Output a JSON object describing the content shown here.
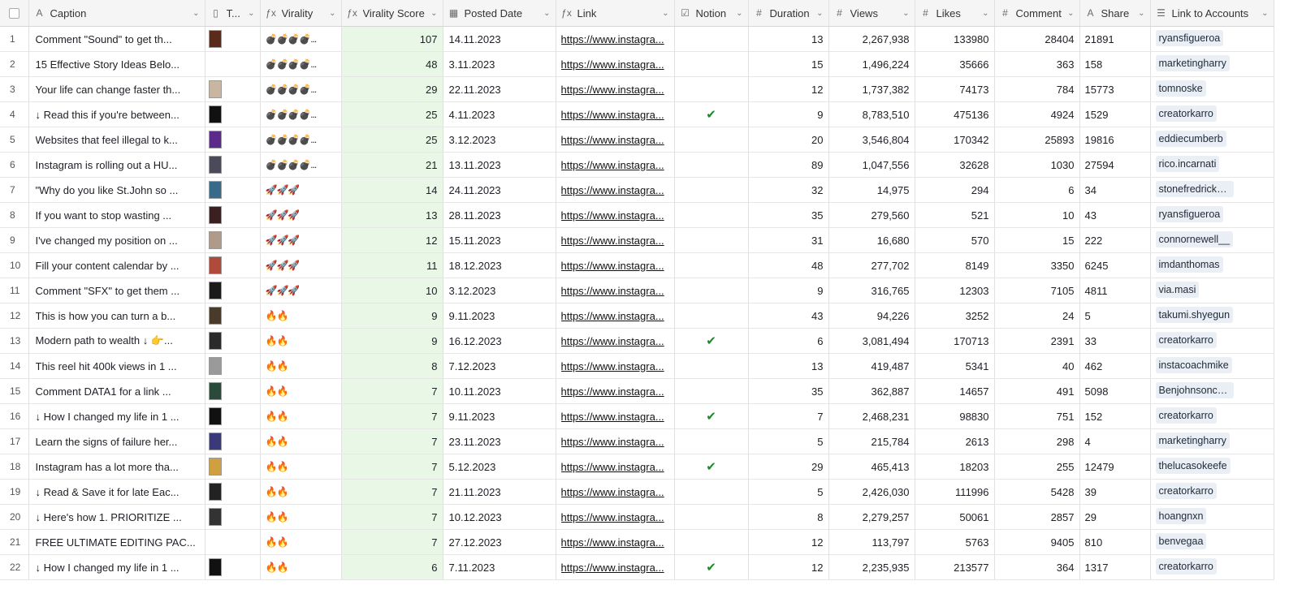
{
  "columns": [
    {
      "label": "Caption",
      "icon": "A"
    },
    {
      "label": "T...",
      "icon": "▯"
    },
    {
      "label": "Virality",
      "icon": "ƒx"
    },
    {
      "label": "Virality Score",
      "icon": "ƒx"
    },
    {
      "label": "Posted Date",
      "icon": "▦"
    },
    {
      "label": "Link",
      "icon": "ƒx"
    },
    {
      "label": "Notion",
      "icon": "☑"
    },
    {
      "label": "Duration",
      "icon": "#"
    },
    {
      "label": "Views",
      "icon": "#"
    },
    {
      "label": "Likes",
      "icon": "#"
    },
    {
      "label": "Comment",
      "icon": "#"
    },
    {
      "label": "Share",
      "icon": "A"
    },
    {
      "label": "Link to Accounts",
      "icon": "☰"
    }
  ],
  "rows": [
    {
      "n": "1",
      "caption": "Comment \"Sound\" to get th...",
      "thumb": true,
      "tc": "#5a2a1a",
      "virality": "💣💣💣💣...",
      "score": "107",
      "date": "14.11.2023",
      "link": "https://www.instagra...",
      "notion": false,
      "duration": "13",
      "views": "2,267,938",
      "likes": "133980",
      "comment": "28404",
      "share": "21891",
      "account": "ryansfigueroa"
    },
    {
      "n": "2",
      "caption": "15 Effective Story Ideas Belo...",
      "thumb": false,
      "tc": "",
      "virality": "💣💣💣💣...",
      "score": "48",
      "date": "3.11.2023",
      "link": "https://www.instagra...",
      "notion": false,
      "duration": "15",
      "views": "1,496,224",
      "likes": "35666",
      "comment": "363",
      "share": "158",
      "account": "marketingharry"
    },
    {
      "n": "3",
      "caption": "Your life can change faster th...",
      "thumb": true,
      "tc": "#c8b6a0",
      "virality": "💣💣💣💣...",
      "score": "29",
      "date": "22.11.2023",
      "link": "https://www.instagra...",
      "notion": false,
      "duration": "12",
      "views": "1,737,382",
      "likes": "74173",
      "comment": "784",
      "share": "15773",
      "account": "tomnoske"
    },
    {
      "n": "4",
      "caption": "↓ Read this if you're between...",
      "thumb": true,
      "tc": "#111111",
      "virality": "💣💣💣💣...",
      "score": "25",
      "date": "4.11.2023",
      "link": "https://www.instagra...",
      "notion": true,
      "duration": "9",
      "views": "8,783,510",
      "likes": "475136",
      "comment": "4924",
      "share": "1529",
      "account": "creatorkarro"
    },
    {
      "n": "5",
      "caption": "Websites that feel illegal to k...",
      "thumb": true,
      "tc": "#5b2a8a",
      "virality": "💣💣💣💣...",
      "score": "25",
      "date": "3.12.2023",
      "link": "https://www.instagra...",
      "notion": false,
      "duration": "20",
      "views": "3,546,804",
      "likes": "170342",
      "comment": "25893",
      "share": "19816",
      "account": "eddiecumberb"
    },
    {
      "n": "6",
      "caption": "Instagram is rolling out a HU...",
      "thumb": true,
      "tc": "#4a4a5a",
      "virality": "💣💣💣💣...",
      "score": "21",
      "date": "13.11.2023",
      "link": "https://www.instagra...",
      "notion": false,
      "duration": "89",
      "views": "1,047,556",
      "likes": "32628",
      "comment": "1030",
      "share": "27594",
      "account": "rico.incarnati"
    },
    {
      "n": "7",
      "caption": "\"Why do you like St.John so ...",
      "thumb": true,
      "tc": "#3a6a8a",
      "virality": "🚀🚀🚀",
      "score": "14",
      "date": "24.11.2023",
      "link": "https://www.instagra...",
      "notion": false,
      "duration": "32",
      "views": "14,975",
      "likes": "294",
      "comment": "6",
      "share": "34",
      "account": "stonefredrickson"
    },
    {
      "n": "8",
      "caption": "If you want to stop wasting ...",
      "thumb": true,
      "tc": "#3a2020",
      "virality": "🚀🚀🚀",
      "score": "13",
      "date": "28.11.2023",
      "link": "https://www.instagra...",
      "notion": false,
      "duration": "35",
      "views": "279,560",
      "likes": "521",
      "comment": "10",
      "share": "43",
      "account": "ryansfigueroa"
    },
    {
      "n": "9",
      "caption": "I've changed my position on ...",
      "thumb": true,
      "tc": "#b09a8a",
      "virality": "🚀🚀🚀",
      "score": "12",
      "date": "15.11.2023",
      "link": "https://www.instagra...",
      "notion": false,
      "duration": "31",
      "views": "16,680",
      "likes": "570",
      "comment": "15",
      "share": "222",
      "account": "connornewell__"
    },
    {
      "n": "10",
      "caption": "Fill your content calendar by ...",
      "thumb": true,
      "tc": "#b04a3a",
      "virality": "🚀🚀🚀",
      "score": "11",
      "date": "18.12.2023",
      "link": "https://www.instagra...",
      "notion": false,
      "duration": "48",
      "views": "277,702",
      "likes": "8149",
      "comment": "3350",
      "share": "6245",
      "account": "imdanthomas"
    },
    {
      "n": "11",
      "caption": "Comment \"SFX\" to get them ...",
      "thumb": true,
      "tc": "#1a1a1a",
      "virality": "🚀🚀🚀",
      "score": "10",
      "date": "3.12.2023",
      "link": "https://www.instagra...",
      "notion": false,
      "duration": "9",
      "views": "316,765",
      "likes": "12303",
      "comment": "7105",
      "share": "4811",
      "account": "via.masi"
    },
    {
      "n": "12",
      "caption": "This is how you can turn a b...",
      "thumb": true,
      "tc": "#4a3a2a",
      "virality": "🔥🔥",
      "score": "9",
      "date": "9.11.2023",
      "link": "https://www.instagra...",
      "notion": false,
      "duration": "43",
      "views": "94,226",
      "likes": "3252",
      "comment": "24",
      "share": "5",
      "account": "takumi.shyegun"
    },
    {
      "n": "13",
      "caption": "Modern path to wealth ↓ 👉...",
      "thumb": true,
      "tc": "#2a2a2a",
      "virality": "🔥🔥",
      "score": "9",
      "date": "16.12.2023",
      "link": "https://www.instagra...",
      "notion": true,
      "duration": "6",
      "views": "3,081,494",
      "likes": "170713",
      "comment": "2391",
      "share": "33",
      "account": "creatorkarro"
    },
    {
      "n": "14",
      "caption": "This reel hit 400k views in 1 ...",
      "thumb": true,
      "tc": "#9a9a9a",
      "virality": "🔥🔥",
      "score": "8",
      "date": "7.12.2023",
      "link": "https://www.instagra...",
      "notion": false,
      "duration": "13",
      "views": "419,487",
      "likes": "5341",
      "comment": "40",
      "share": "462",
      "account": "instacoachmike"
    },
    {
      "n": "15",
      "caption": "Comment DATA1 for a link ...",
      "thumb": true,
      "tc": "#2a4a3a",
      "virality": "🔥🔥",
      "score": "7",
      "date": "10.11.2023",
      "link": "https://www.instagra...",
      "notion": false,
      "duration": "35",
      "views": "362,887",
      "likes": "14657",
      "comment": "491",
      "share": "5098",
      "account": "Benjohnsoncreative"
    },
    {
      "n": "16",
      "caption": "↓ How I changed my life in 1 ...",
      "thumb": true,
      "tc": "#111111",
      "virality": "🔥🔥",
      "score": "7",
      "date": "9.11.2023",
      "link": "https://www.instagra...",
      "notion": true,
      "duration": "7",
      "views": "2,468,231",
      "likes": "98830",
      "comment": "751",
      "share": "152",
      "account": "creatorkarro"
    },
    {
      "n": "17",
      "caption": "Learn the signs of failure her...",
      "thumb": true,
      "tc": "#3a3a7a",
      "virality": "🔥🔥",
      "score": "7",
      "date": "23.11.2023",
      "link": "https://www.instagra...",
      "notion": false,
      "duration": "5",
      "views": "215,784",
      "likes": "2613",
      "comment": "298",
      "share": "4",
      "account": "marketingharry"
    },
    {
      "n": "18",
      "caption": "Instagram has a lot more tha...",
      "thumb": true,
      "tc": "#d0a040",
      "virality": "🔥🔥",
      "score": "7",
      "date": "5.12.2023",
      "link": "https://www.instagra...",
      "notion": true,
      "duration": "29",
      "views": "465,413",
      "likes": "18203",
      "comment": "255",
      "share": "12479",
      "account": "thelucasokeefe"
    },
    {
      "n": "19",
      "caption": "↓ Read & Save it for late Eac...",
      "thumb": true,
      "tc": "#222222",
      "virality": "🔥🔥",
      "score": "7",
      "date": "21.11.2023",
      "link": "https://www.instagra...",
      "notion": false,
      "duration": "5",
      "views": "2,426,030",
      "likes": "111996",
      "comment": "5428",
      "share": "39",
      "account": "creatorkarro"
    },
    {
      "n": "20",
      "caption": "↓ Here's how 1. PRIORITIZE ...",
      "thumb": true,
      "tc": "#333333",
      "virality": "🔥🔥",
      "score": "7",
      "date": "10.12.2023",
      "link": "https://www.instagra...",
      "notion": false,
      "duration": "8",
      "views": "2,279,257",
      "likes": "50061",
      "comment": "2857",
      "share": "29",
      "account": "hoangnxn"
    },
    {
      "n": "21",
      "caption": "FREE ULTIMATE EDITING PAC...",
      "thumb": false,
      "tc": "",
      "virality": "🔥🔥",
      "score": "7",
      "date": "27.12.2023",
      "link": "https://www.instagra...",
      "notion": false,
      "duration": "12",
      "views": "113,797",
      "likes": "5763",
      "comment": "9405",
      "share": "810",
      "account": "benvegaa"
    },
    {
      "n": "22",
      "caption": "↓ How I changed my life in 1 ...",
      "thumb": true,
      "tc": "#111111",
      "virality": "🔥🔥",
      "score": "6",
      "date": "7.11.2023",
      "link": "https://www.instagra...",
      "notion": true,
      "duration": "12",
      "views": "2,235,935",
      "likes": "213577",
      "comment": "364",
      "share": "1317",
      "account": "creatorkarro"
    }
  ],
  "colors": {
    "score_bg": "#e9f8e6",
    "check": "#1a8a2a",
    "pill_bg": "#eaeef5"
  }
}
